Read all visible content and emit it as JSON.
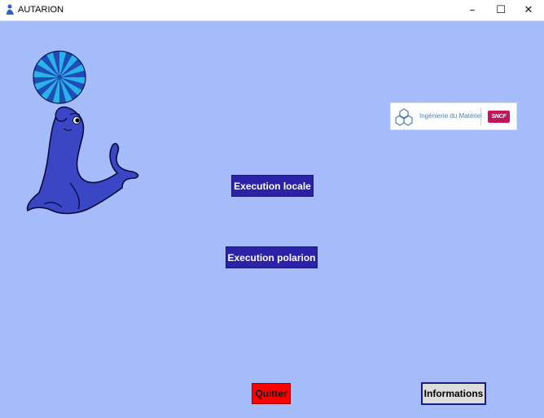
{
  "window": {
    "title": "AUTARION",
    "controls": {
      "minimize": "–",
      "maximize": "☐",
      "close": "✕"
    }
  },
  "logo": {
    "text": "Ingénierie du Matériel",
    "brand": "SNCF"
  },
  "buttons": {
    "execution_locale": "Execution locale",
    "execution_polarion": "Execution polarion",
    "quitter": "Quitter",
    "informations": "Informations"
  },
  "colors": {
    "background": "#a5bbfa",
    "primary_button": "#2b22a8",
    "quit_button": "#ff0000",
    "seal": "#3b46c4",
    "ball_dark": "#1e4db6",
    "ball_light": "#29b3e8"
  },
  "icons": {
    "app": "seal-app-icon",
    "illustration": "seal-with-ball-illustration"
  }
}
